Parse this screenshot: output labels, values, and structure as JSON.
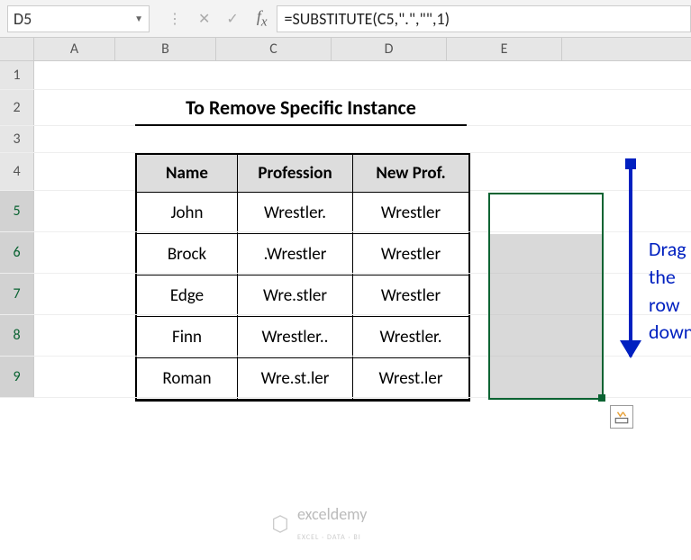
{
  "formula_bar": {
    "cell_ref": "D5",
    "formula": "=SUBSTITUTE(C5,\".\",\"\",1)"
  },
  "columns": [
    "A",
    "B",
    "C",
    "D",
    "E"
  ],
  "row_numbers": [
    "1",
    "2",
    "3",
    "4",
    "5",
    "6",
    "7",
    "8",
    "9"
  ],
  "title": "To Remove Specific Instance",
  "table": {
    "headers": {
      "name": "Name",
      "profession": "Profession",
      "new_prof": "New Prof."
    },
    "rows": [
      {
        "name": "John",
        "profession": "Wrestler.",
        "new_prof": "Wrestler"
      },
      {
        "name": "Brock",
        "profession": ".Wrestler",
        "new_prof": "Wrestler"
      },
      {
        "name": "Edge",
        "profession": "Wre.stler",
        "new_prof": "Wrestler"
      },
      {
        "name": "Finn",
        "profession": "Wrestler..",
        "new_prof": "Wrestler."
      },
      {
        "name": "Roman",
        "profession": "Wre.st.ler",
        "new_prof": "Wrest.ler"
      }
    ]
  },
  "annotation": {
    "drag_line1": "Drag the",
    "drag_line2": "row down"
  },
  "watermark": {
    "brand": "exceldemy",
    "tagline": "EXCEL · DATA · BI"
  },
  "chart_data": {
    "type": "table",
    "title": "To Remove Specific Instance",
    "columns": [
      "Name",
      "Profession",
      "New Prof."
    ],
    "rows": [
      [
        "John",
        "Wrestler.",
        "Wrestler"
      ],
      [
        "Brock",
        ".Wrestler",
        "Wrestler"
      ],
      [
        "Edge",
        "Wre.stler",
        "Wrestler"
      ],
      [
        "Finn",
        "Wrestler..",
        "Wrestler."
      ],
      [
        "Roman",
        "Wre.st.ler",
        "Wrest.ler"
      ]
    ],
    "formula_applied": "=SUBSTITUTE(C5,\".\",\"\",1)",
    "selected_cell": "D5",
    "fill_range": "D5:D9"
  }
}
